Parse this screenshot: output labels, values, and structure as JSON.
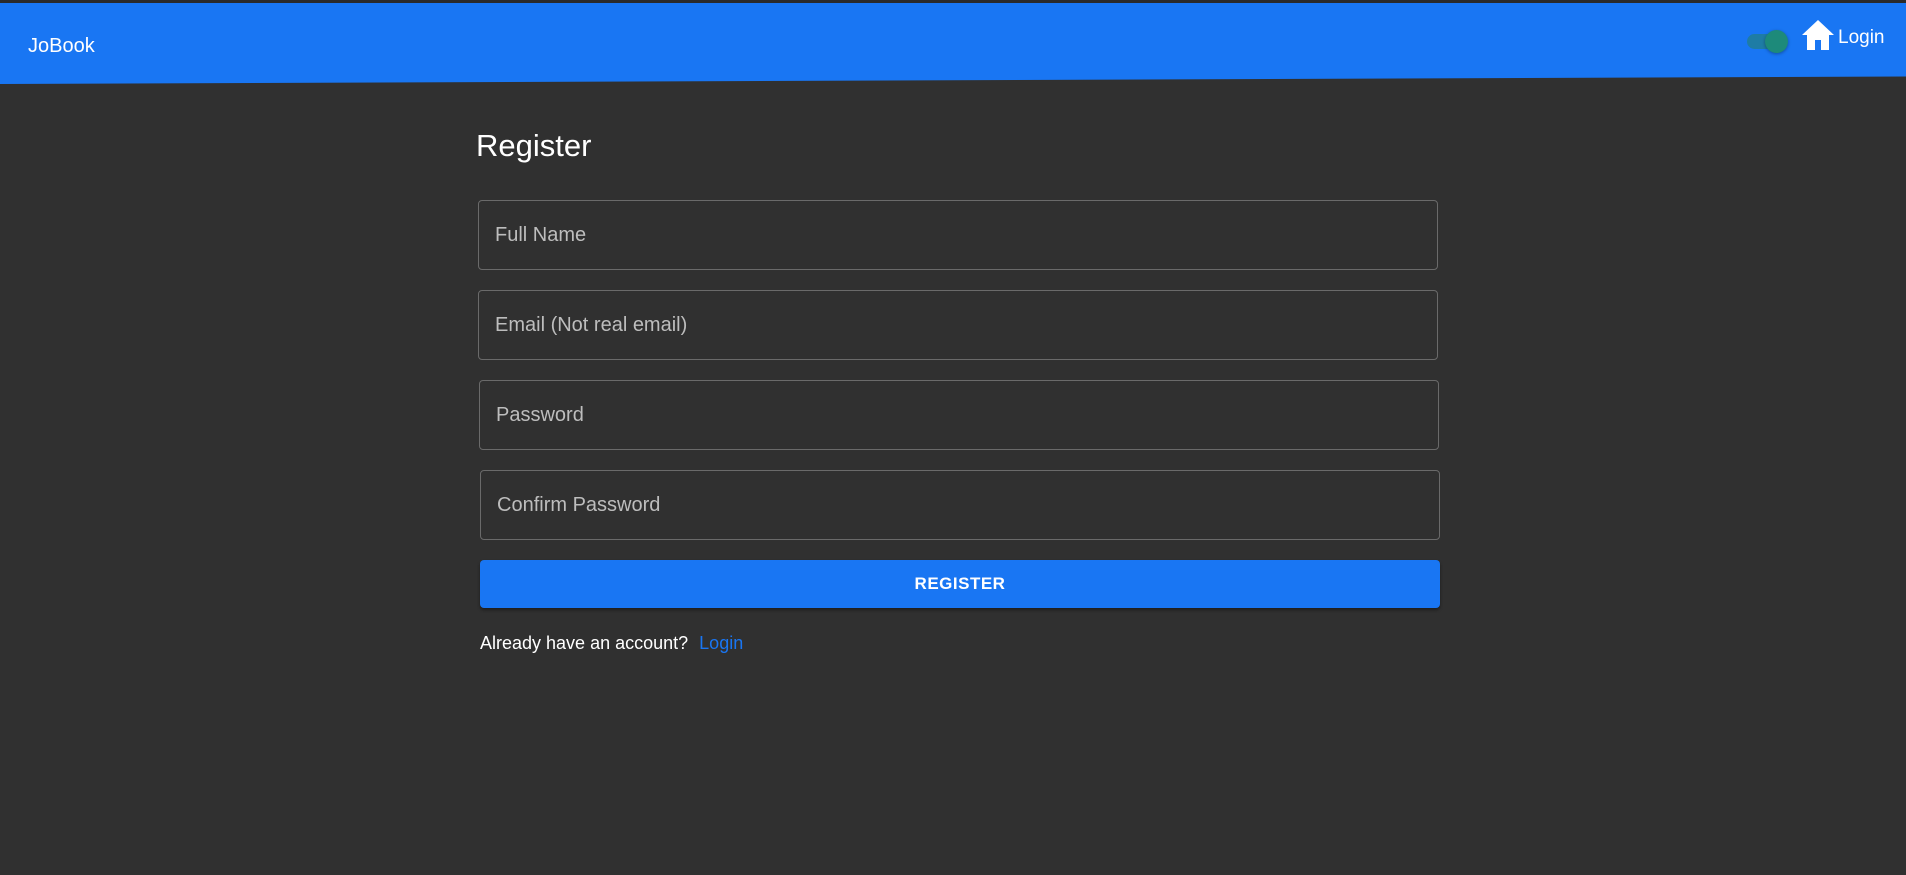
{
  "appbar": {
    "brand": "JoBook",
    "theme_toggle": {
      "on": true
    },
    "home_icon": "home-icon",
    "login_label": "Login"
  },
  "form": {
    "title": "Register",
    "fields": [
      {
        "placeholder": "Full Name"
      },
      {
        "placeholder": "Email (Not real email)"
      },
      {
        "placeholder": "Password"
      },
      {
        "placeholder": "Confirm Password"
      }
    ],
    "submit_label": "REGISTER",
    "footer_text": "Already have an account?",
    "footer_link": "Login"
  },
  "colors": {
    "primary": "#1976f3",
    "background": "#303030",
    "field_border": "#6a6a6a",
    "toggle_thumb": "#1d8a7a"
  }
}
